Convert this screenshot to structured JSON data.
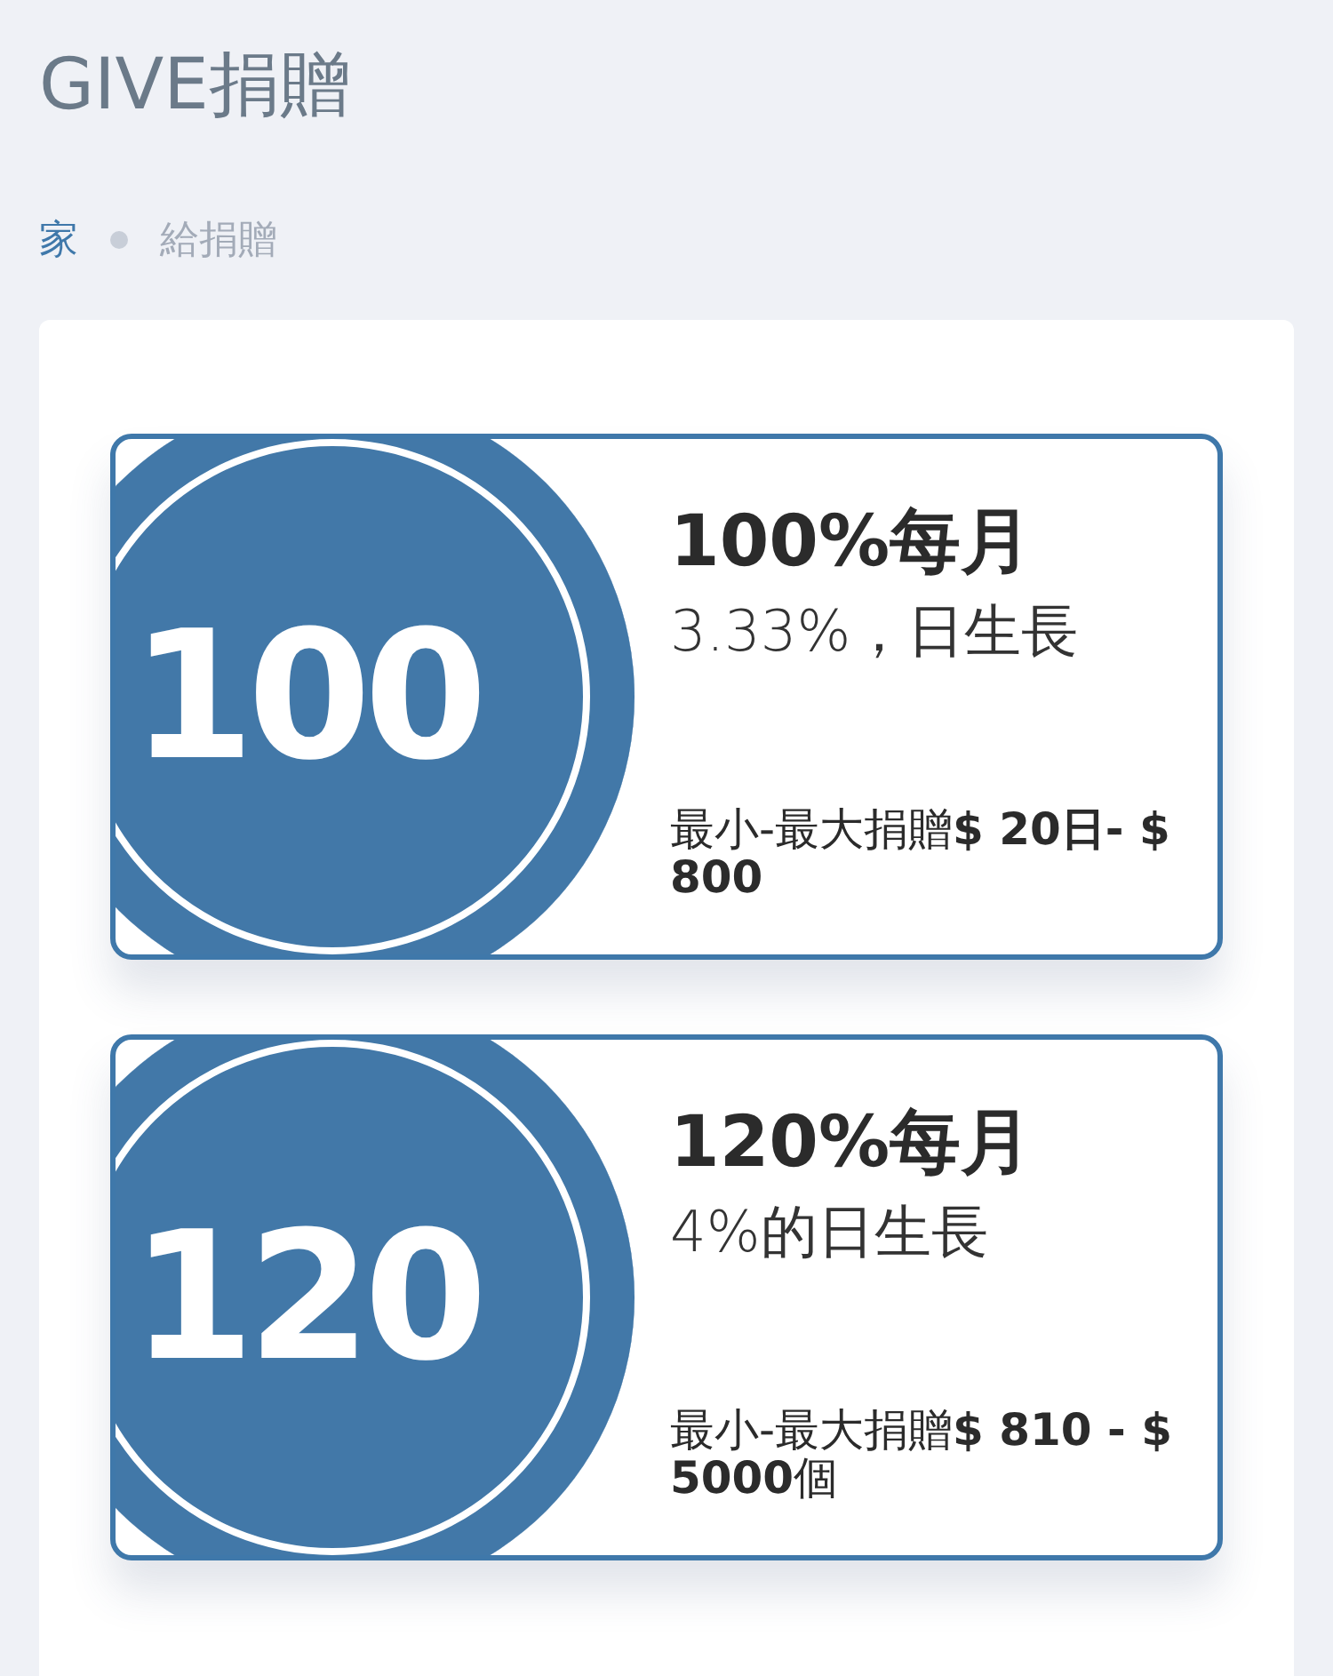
{
  "page_title": "GIVE捐贈",
  "breadcrumb": [
    {
      "label": "家",
      "kind": "link"
    },
    {
      "label": "給捐贈",
      "kind": "current"
    }
  ],
  "plans": [
    {
      "badge": "100",
      "title": "100%每月",
      "growth": "3.33%，日生長",
      "range": "最小-最大捐贈**$ 20日- $ 800**"
    },
    {
      "badge": "120",
      "title": "120%每月",
      "growth": "4%的日生長",
      "range": "最小-最大捐贈**$ 810 - $ 5000**個"
    }
  ]
}
